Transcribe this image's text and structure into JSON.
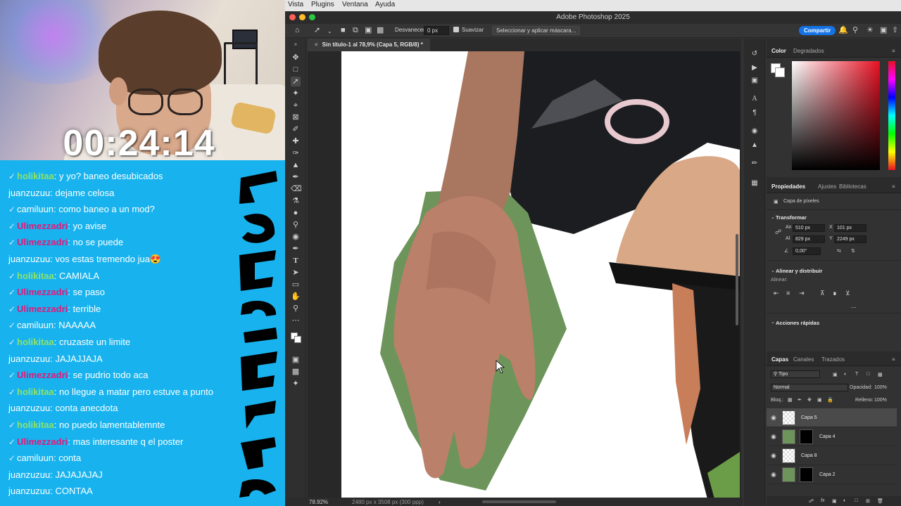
{
  "stream": {
    "timer": "00:24:14",
    "chat": [
      {
        "user": "holikitaa",
        "color": "green",
        "badge": true,
        "text": "y yo? baneo desubicados"
      },
      {
        "user": "juanzuzuu",
        "color": "white",
        "badge": false,
        "text": "dejame celosa"
      },
      {
        "user": "camiluun",
        "color": "white",
        "badge": true,
        "text": "como baneo a un mod?"
      },
      {
        "user": "Ulimezzadri",
        "color": "pink",
        "badge": true,
        "text": "yo avise"
      },
      {
        "user": "Ulimezzadri",
        "color": "pink",
        "badge": true,
        "text": "no se puede"
      },
      {
        "user": "juanzuzuu",
        "color": "white",
        "badge": false,
        "text": "vos estas tremendo jua😍"
      },
      {
        "user": "holikitaa",
        "color": "green",
        "badge": true,
        "text": "CAMIALA"
      },
      {
        "user": "Ulimezzadri",
        "color": "pink",
        "badge": true,
        "text": "se paso"
      },
      {
        "user": "Ulimezzadri",
        "color": "pink",
        "badge": true,
        "text": "terrible"
      },
      {
        "user": "camiluun",
        "color": "white",
        "badge": true,
        "text": "NAAAAA"
      },
      {
        "user": "holikitaa",
        "color": "green",
        "badge": true,
        "text": "cruzaste un limite"
      },
      {
        "user": "juanzuzuu",
        "color": "white",
        "badge": false,
        "text": "JAJAJJAJA"
      },
      {
        "user": "Ulimezzadri",
        "color": "pink",
        "badge": true,
        "text": "se pudrio todo aca"
      },
      {
        "user": "holikitaa",
        "color": "green",
        "badge": true,
        "text": "no llegue a matar pero estuve a punto"
      },
      {
        "user": "juanzuzuu",
        "color": "white",
        "badge": false,
        "text": "conta anecdota"
      },
      {
        "user": "holikitaa",
        "color": "green",
        "badge": true,
        "text": "no puedo lamentablemnte"
      },
      {
        "user": "Ulimezzadri",
        "color": "pink",
        "badge": true,
        "text": "mas interesante q el poster"
      },
      {
        "user": "camiluun",
        "color": "white",
        "badge": true,
        "text": "conta"
      },
      {
        "user": "juanzuzuu",
        "color": "white",
        "badge": false,
        "text": "JAJAJAJAJ"
      },
      {
        "user": "juanzuzuu",
        "color": "white",
        "badge": false,
        "text": "CONTAA"
      }
    ],
    "chat_colors": {
      "green": "#8de36a",
      "pink": "#e0197a",
      "white": "#ffffff",
      "bg": "#18b3ee"
    }
  },
  "menubar": {
    "items": [
      "Vista",
      "Plugins",
      "Ventana",
      "Ayuda"
    ]
  },
  "app": {
    "title": "Adobe Photoshop 2025",
    "share_label": "Compartir"
  },
  "options": {
    "feather_label": "Desvanecer:",
    "feather_value": "0 px",
    "smooth_label": "Suavizar",
    "select_mask_label": "Seleccionar y aplicar máscara..."
  },
  "document": {
    "tab_title": "Sin título-1 al 78,9% (Capa 5, RGB/8) *",
    "zoom": "78.92%",
    "size_info": "2480 px x 3508 px (300 ppp)"
  },
  "color_panel": {
    "tabs": [
      "Color",
      "Degradados"
    ],
    "active": "Color"
  },
  "properties_panel": {
    "tabs": [
      "Propiedades",
      "Ajustes",
      "Bibliotecas"
    ],
    "layer_type": "Capa de píxeles",
    "transform_header": "Transformar",
    "w_label": "An",
    "w_value": "510 px",
    "h_label": "Al",
    "h_value": "829 px",
    "x_label": "X",
    "x_value": "101 px",
    "y_label": "Y",
    "y_value": "2249 px",
    "angle_value": "0,00°",
    "align_header": "Alinear y distribuir",
    "align_label": "Alinear:",
    "more_label": "...",
    "quick_actions_header": "Acciones rápidas"
  },
  "layers_panel": {
    "tabs": [
      "Capas",
      "Canales",
      "Trazados"
    ],
    "filter_label": "Tipo",
    "blend_mode": "Normal",
    "opacity_label": "Opacidad:",
    "opacity_value": "100%",
    "lock_label": "Bloq.:",
    "fill_label": "Relleno:",
    "fill_value": "100%",
    "layers": [
      {
        "name": "Capa 5",
        "selected": true,
        "mask": false
      },
      {
        "name": "Capa 4",
        "selected": false,
        "mask": true
      },
      {
        "name": "Capa 8",
        "selected": false,
        "mask": false
      },
      {
        "name": "Capa 2",
        "selected": false,
        "mask": true
      }
    ]
  },
  "colors": {
    "accent": "#1473e6",
    "ps_bg": "#323232",
    "panel_bg": "#2b2b2b"
  }
}
